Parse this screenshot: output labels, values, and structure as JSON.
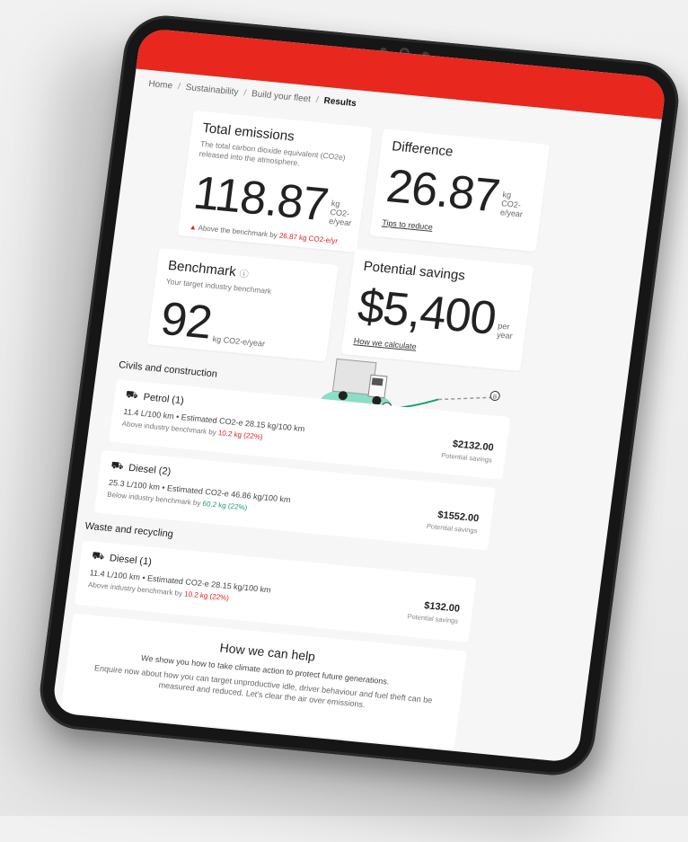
{
  "breadcrumb": {
    "home": "Home",
    "sustainability": "Sustainability",
    "build": "Build your fleet",
    "results": "Results",
    "sep": "/"
  },
  "total": {
    "title": "Total emissions",
    "desc": "The total carbon dioxide equivalent (CO2e) released into the atmosphere.",
    "value": "118.87",
    "unit": "kg CO2-e/year",
    "warn_prefix": "Above the benchmark by",
    "warn_value": "26.87 kg CO2-e/yr"
  },
  "difference": {
    "title": "Difference",
    "value": "26.87",
    "unit": "kg CO2-e/year",
    "link": "Tips to reduce"
  },
  "benchmark": {
    "title": "Benchmark",
    "desc": "Your target industry benchmark",
    "value": "92",
    "unit": "kg CO2-e/year"
  },
  "savings": {
    "title": "Potential savings",
    "value": "$5,400",
    "unit": "per year",
    "link": "How we calculate"
  },
  "route": {
    "a": "A",
    "b": "B"
  },
  "sections": [
    {
      "label": "Civils and construction",
      "items": [
        {
          "title": "Petrol (1)",
          "sub": "11.4 L/100 km • Estimated CO2-e 28.15 kg/100 km",
          "bench_prefix": "Above industry benchmark by",
          "bench_value": "10.2 kg (22%)",
          "amount": "$2132.00",
          "amount_label": "Potential savings"
        },
        {
          "title": "Diesel (2)",
          "sub": "25.3 L/100 km • Estimated CO2-e 46.86 kg/100 km",
          "bench_prefix": "Below industry benchmark by",
          "bench_value": "60.2 kg (22%)",
          "amount": "$1552.00",
          "amount_label": "Potential savings"
        }
      ]
    },
    {
      "label": "Waste and recycling",
      "items": [
        {
          "title": "Diesel (1)",
          "sub": "11.4 L/100 km • Estimated CO2-e 28.15 kg/100 km",
          "bench_prefix": "Above industry benchmark by",
          "bench_value": "10.2 kg (22%)",
          "amount": "$132.00",
          "amount_label": "Potential savings"
        }
      ]
    }
  ],
  "help": {
    "title": "How we can help",
    "lead": "We show you how to take climate action to protect future generations.",
    "body": "Enquire now about how you can target unproductive idle, driver behaviour and fuel theft can be measured and reduced. Let's clear the air over emissions."
  },
  "colors": {
    "brand": "#e8281e",
    "warn": "#e02020",
    "good": "#1aa06a"
  }
}
